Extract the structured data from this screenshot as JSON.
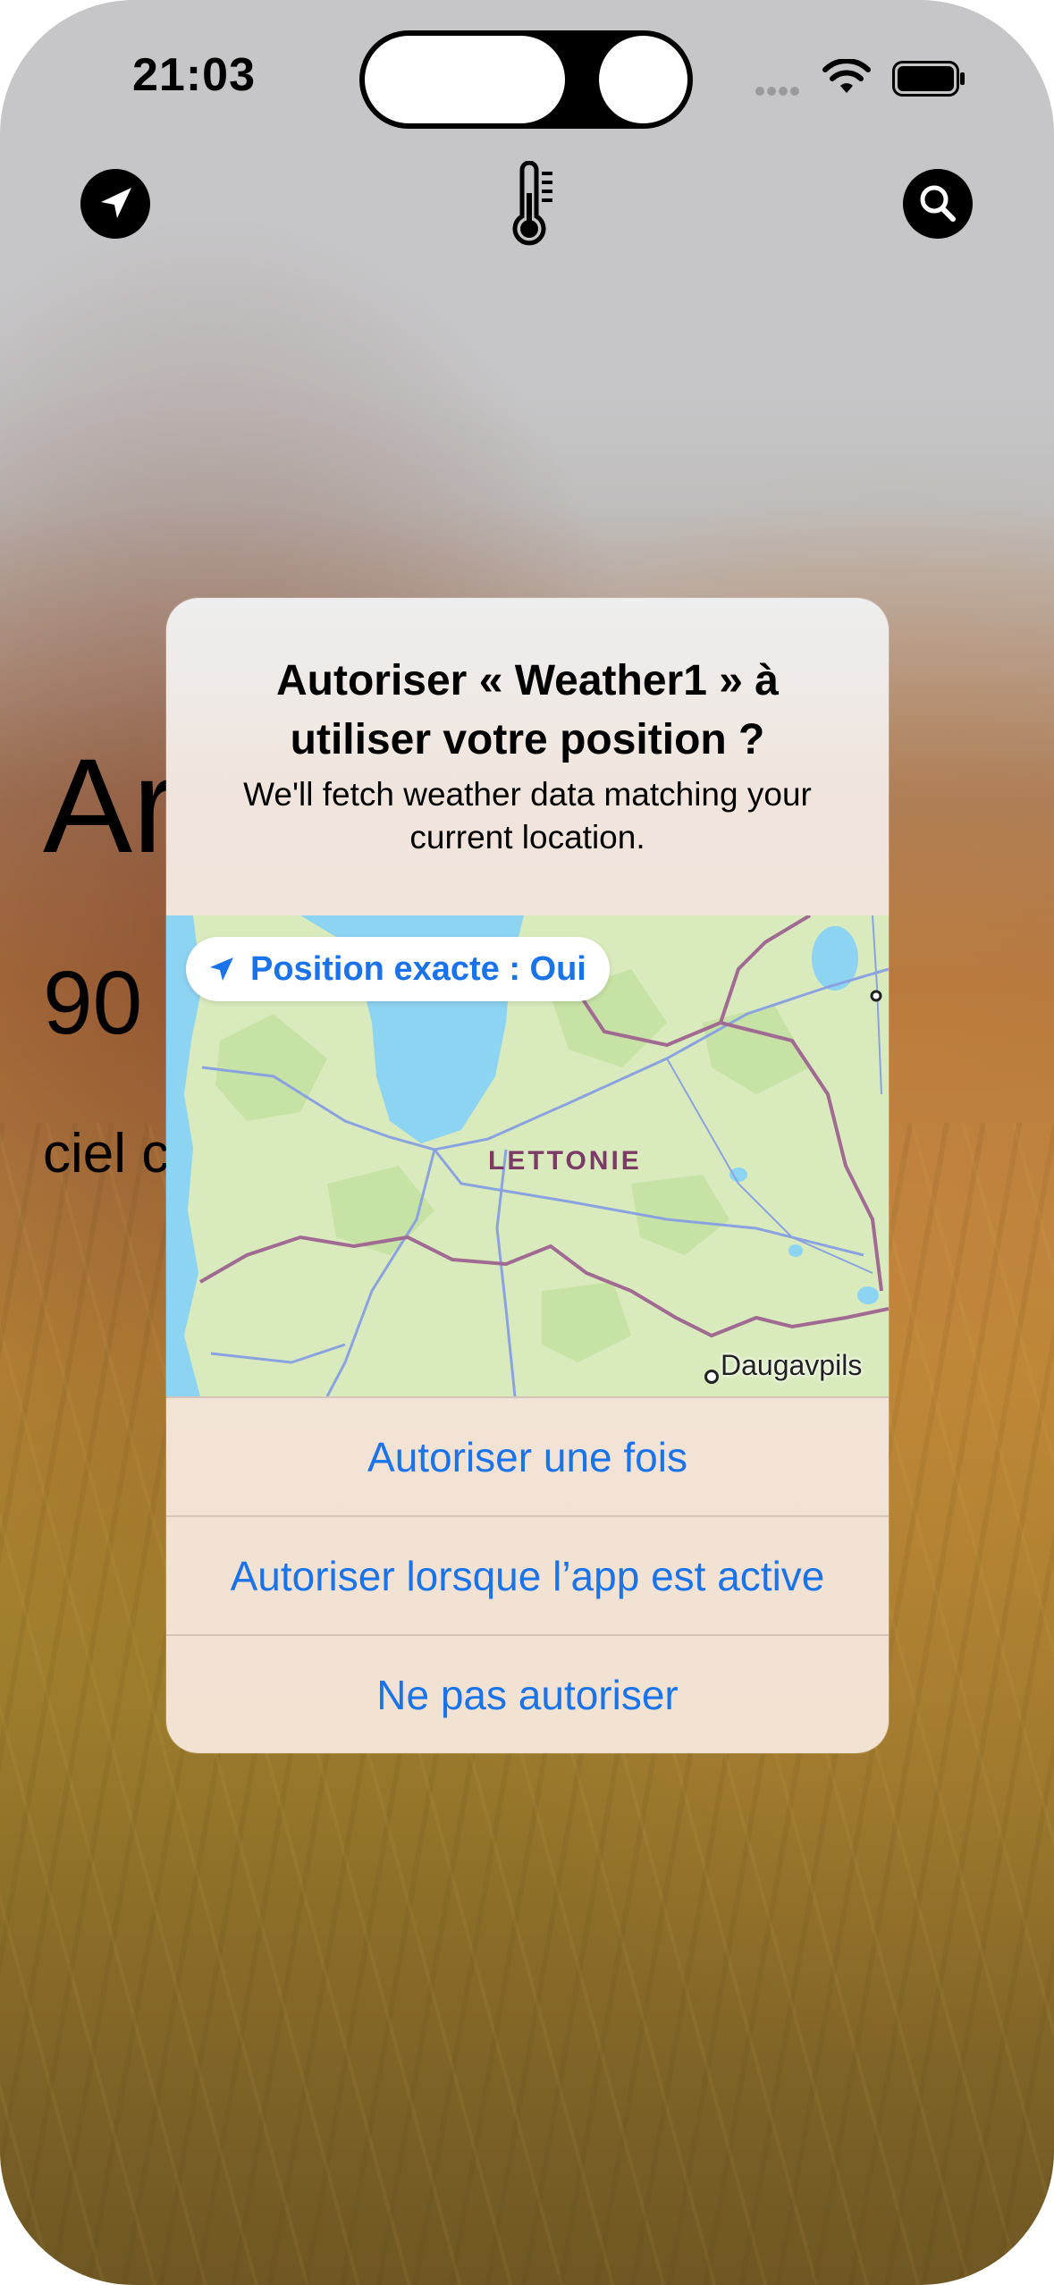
{
  "status_bar": {
    "time": "21:03"
  },
  "toolbar": {
    "location_icon": "location-arrow-icon",
    "center_icon": "thermometer-icon",
    "search_icon": "search-icon"
  },
  "background": {
    "city_partial": "Ar",
    "temp_partial": "90",
    "desc_partial": "ciel c"
  },
  "alert": {
    "title": "Autoriser « Weather1 » à utiliser votre position ?",
    "message": "We'll fetch weather data matching your current location.",
    "precise_location_label": "Position exacte : Oui",
    "map": {
      "country_label": "LETTONIE",
      "city_label": "Daugavpils"
    },
    "buttons": {
      "allow_once": "Autoriser une fois",
      "allow_while_using": "Autoriser lorsque l’app est active",
      "dont_allow": "Ne pas autoriser"
    }
  },
  "colors": {
    "accent_blue": "#1a73e8",
    "map_land": "#d9ebbd",
    "map_water": "#8dd3f2",
    "border_line": "#9c6b8e"
  }
}
